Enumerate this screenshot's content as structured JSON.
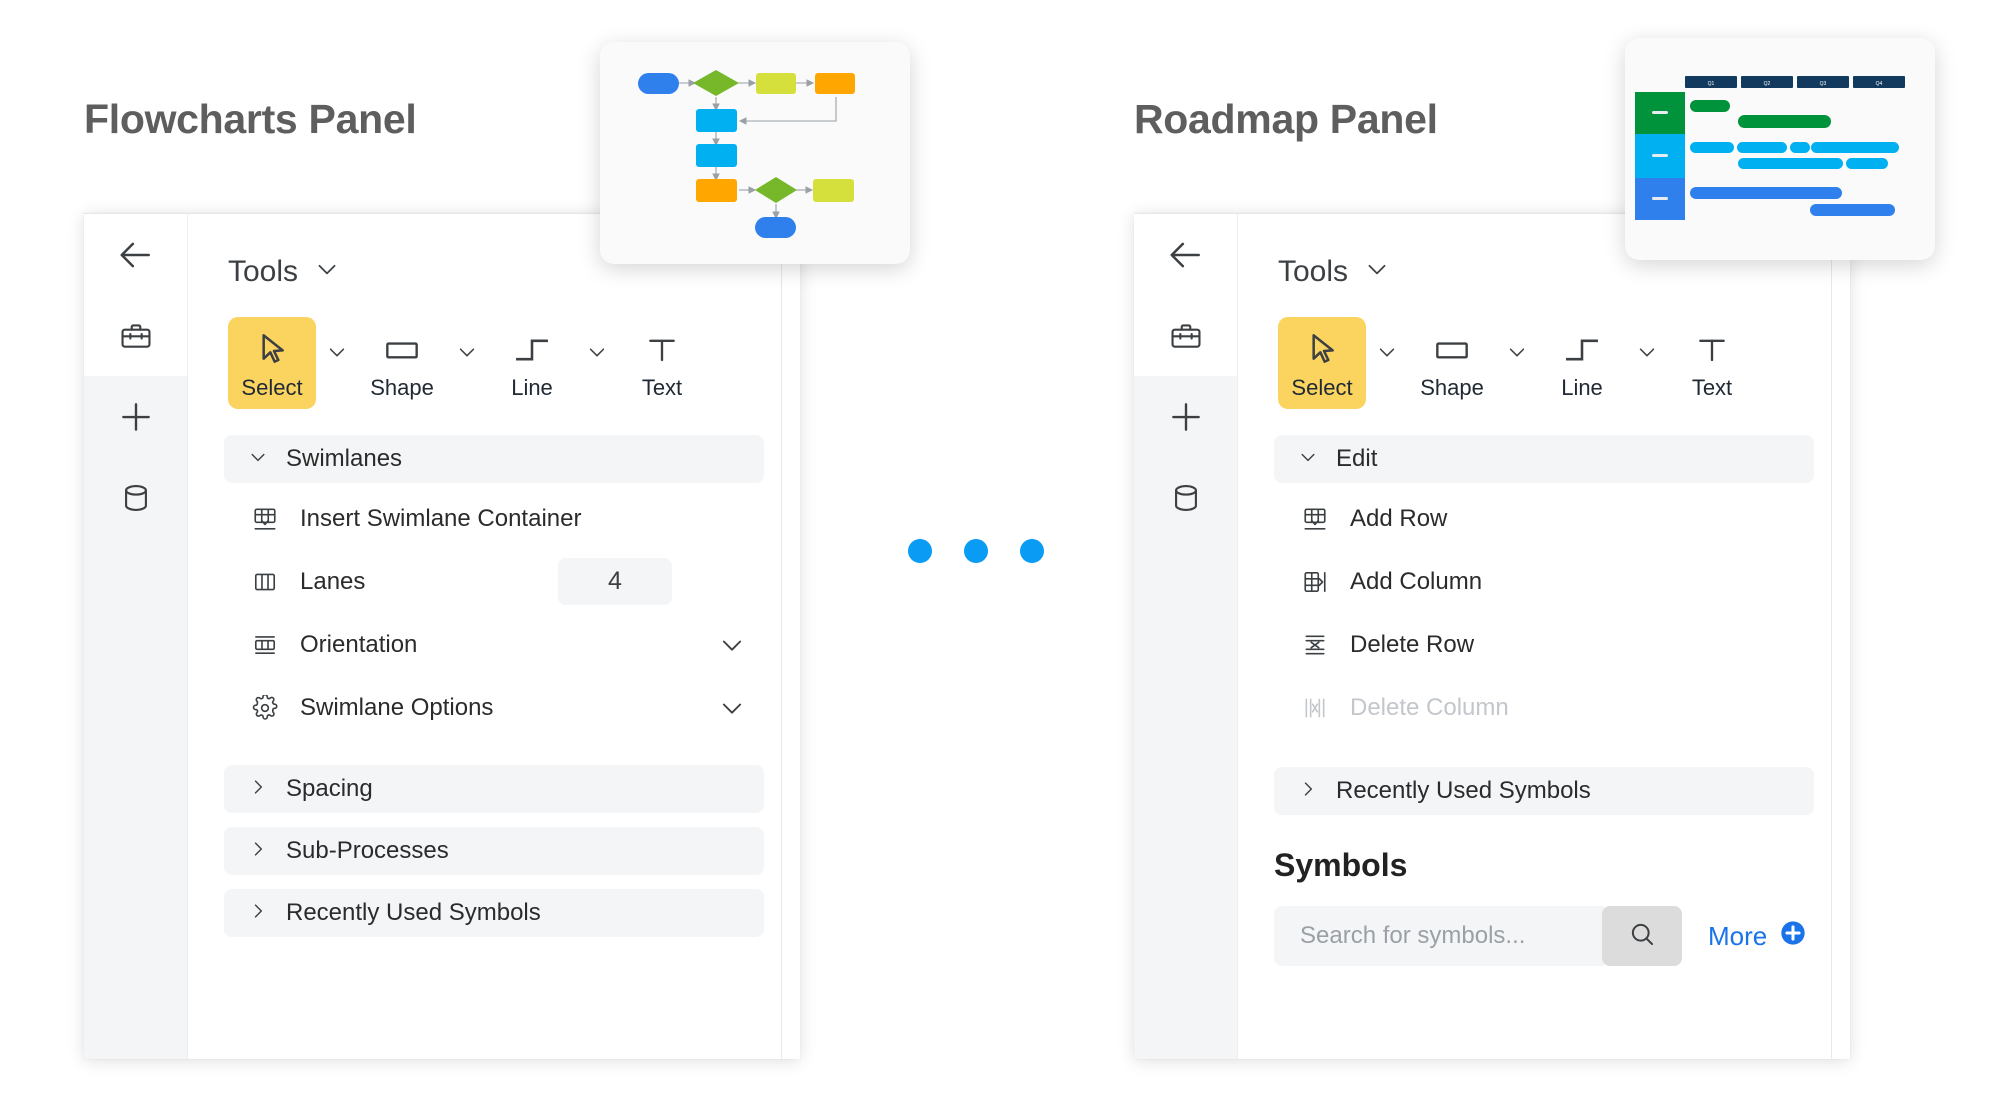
{
  "panels": [
    {
      "title": "Flowcharts Panel",
      "rail": [
        {
          "icon": "back-arrow-icon",
          "name": "back-button"
        },
        {
          "icon": "toolbox-icon",
          "name": "toolbox-button"
        },
        {
          "icon": "plus-icon",
          "name": "add-button"
        },
        {
          "icon": "database-icon",
          "name": "data-button"
        }
      ],
      "header": {
        "label": "Tools",
        "caret": "chevron-down-icon"
      },
      "tools": [
        {
          "label": "Select",
          "icon": "cursor-arrow-icon",
          "selected": true,
          "caret": true
        },
        {
          "label": "Shape",
          "icon": "rectangle-icon",
          "selected": false,
          "caret": true
        },
        {
          "label": "Line",
          "icon": "elbow-line-icon",
          "selected": false,
          "caret": true
        },
        {
          "label": "Text",
          "icon": "text-t-icon",
          "selected": false,
          "caret": false
        }
      ],
      "group": {
        "label": "Swimlanes",
        "expanded": true
      },
      "items": [
        {
          "label": "Insert Swimlane Container",
          "icon": "insert-swimlane-icon",
          "control": "none",
          "disabled": false
        },
        {
          "label": "Lanes",
          "icon": "lanes-icon",
          "control": "number",
          "value": "4",
          "disabled": false
        },
        {
          "label": "Orientation",
          "icon": "orientation-icon",
          "control": "chevron",
          "disabled": false
        },
        {
          "label": "Swimlane Options",
          "icon": "gear-icon",
          "control": "chevron",
          "disabled": false
        }
      ],
      "collapsed_sections": [
        {
          "label": "Spacing"
        },
        {
          "label": "Sub-Processes"
        },
        {
          "label": "Recently Used Symbols"
        }
      ],
      "symbols": null,
      "thumbnail": "flowchart-preview"
    },
    {
      "title": "Roadmap Panel",
      "rail": [
        {
          "icon": "back-arrow-icon",
          "name": "back-button"
        },
        {
          "icon": "toolbox-icon",
          "name": "toolbox-button"
        },
        {
          "icon": "plus-icon",
          "name": "add-button"
        },
        {
          "icon": "database-icon",
          "name": "data-button"
        }
      ],
      "header": {
        "label": "Tools",
        "caret": "chevron-down-icon"
      },
      "tools": [
        {
          "label": "Select",
          "icon": "cursor-arrow-icon",
          "selected": true,
          "caret": true
        },
        {
          "label": "Shape",
          "icon": "rectangle-icon",
          "selected": false,
          "caret": true
        },
        {
          "label": "Line",
          "icon": "elbow-line-icon",
          "selected": false,
          "caret": true
        },
        {
          "label": "Text",
          "icon": "text-t-icon",
          "selected": false,
          "caret": false
        }
      ],
      "group": {
        "label": "Edit",
        "expanded": true
      },
      "items": [
        {
          "label": "Add Row",
          "icon": "add-row-icon",
          "control": "none",
          "disabled": false
        },
        {
          "label": "Add Column",
          "icon": "add-column-icon",
          "control": "none",
          "disabled": false
        },
        {
          "label": "Delete Row",
          "icon": "delete-row-icon",
          "control": "none",
          "disabled": false
        },
        {
          "label": "Delete Column",
          "icon": "delete-column-icon",
          "control": "none",
          "disabled": true
        }
      ],
      "collapsed_sections": [
        {
          "label": "Recently Used Symbols"
        }
      ],
      "symbols": {
        "heading": "Symbols",
        "search_placeholder": "Search for symbols...",
        "search_value": "",
        "search_icon": "search-icon",
        "more_label": "More",
        "more_icon": "plus-circle-icon"
      },
      "thumbnail": "roadmap-preview"
    }
  ],
  "pagination": {
    "dots": 3,
    "color": "#0a9bf5"
  },
  "thumbnails": {
    "flowchart": {
      "nodes": [
        {
          "shape": "rounded",
          "color": "#2f80ed"
        },
        {
          "shape": "diamond",
          "color": "#76b82a"
        },
        {
          "shape": "rect",
          "color": "#d6e03d"
        },
        {
          "shape": "rect",
          "color": "#ffa600"
        },
        {
          "shape": "rect",
          "color": "#00b0f0"
        },
        {
          "shape": "rect",
          "color": "#00b0f0"
        },
        {
          "shape": "rect",
          "color": "#ffa600"
        },
        {
          "shape": "diamond",
          "color": "#76b82a"
        },
        {
          "shape": "rect",
          "color": "#d6e03d"
        },
        {
          "shape": "rounded",
          "color": "#2f80ed"
        }
      ]
    },
    "roadmap": {
      "columns": [
        "Q1",
        "Q2",
        "Q3",
        "Q4"
      ],
      "header_color": "#123a5e",
      "lanes": [
        {
          "color": "#00933b"
        },
        {
          "color": "#00b0f0"
        },
        {
          "color": "#2f80ed"
        }
      ]
    }
  },
  "colors": {
    "accent_yellow": "#fbd35f",
    "link_blue": "#1a73e8",
    "dot_blue": "#0a9bf5",
    "rail_bg": "#f4f5f7",
    "title_gray": "#5e5e5e"
  }
}
